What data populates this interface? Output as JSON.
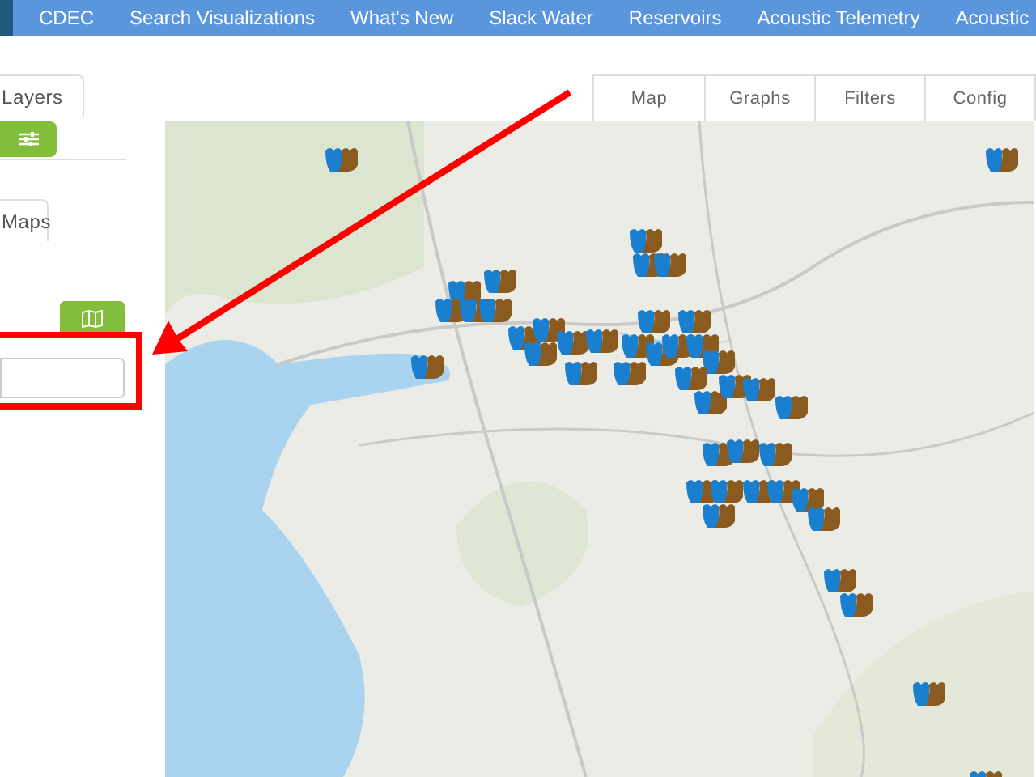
{
  "nav": [
    {
      "label": "CDEC"
    },
    {
      "label": "Search Visualizations"
    },
    {
      "label": "What's New"
    },
    {
      "label": "Slack Water"
    },
    {
      "label": "Reservoirs"
    },
    {
      "label": "Acoustic Telemetry"
    },
    {
      "label": "Acoustic"
    }
  ],
  "sidebar": {
    "tabs": [
      {
        "label": "Layers",
        "selected": true
      },
      {
        "label": "Maps",
        "selected": true
      }
    ]
  },
  "map_tabs": [
    {
      "label": "Map",
      "selected": false
    },
    {
      "label": "Graphs",
      "selected": false
    },
    {
      "label": "Filters",
      "selected": false
    },
    {
      "label": "Config",
      "selected": false
    }
  ]
}
